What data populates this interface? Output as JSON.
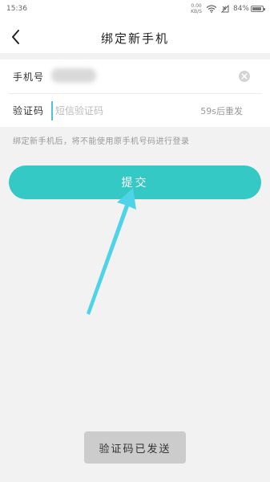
{
  "status_bar": {
    "time": "15:36",
    "net_speed_value": "0.00",
    "net_speed_unit": "KB/S",
    "battery": "84%"
  },
  "nav": {
    "title": "绑定新手机",
    "back_icon": "chevron-left-icon"
  },
  "form": {
    "phone_label": "手机号",
    "code_label": "验证码",
    "code_placeholder": "短信验证码",
    "resend_countdown": "59s后重发",
    "clear_icon": "clear-circle-icon"
  },
  "notice": "绑定新手机后，将不能使用原手机号码进行登录",
  "submit_label": "提交",
  "toast": "验证码已发送",
  "colors": {
    "accent": "#35c9c6",
    "annotation_arrow": "#4fd3e8",
    "background": "#f2f2f2"
  }
}
